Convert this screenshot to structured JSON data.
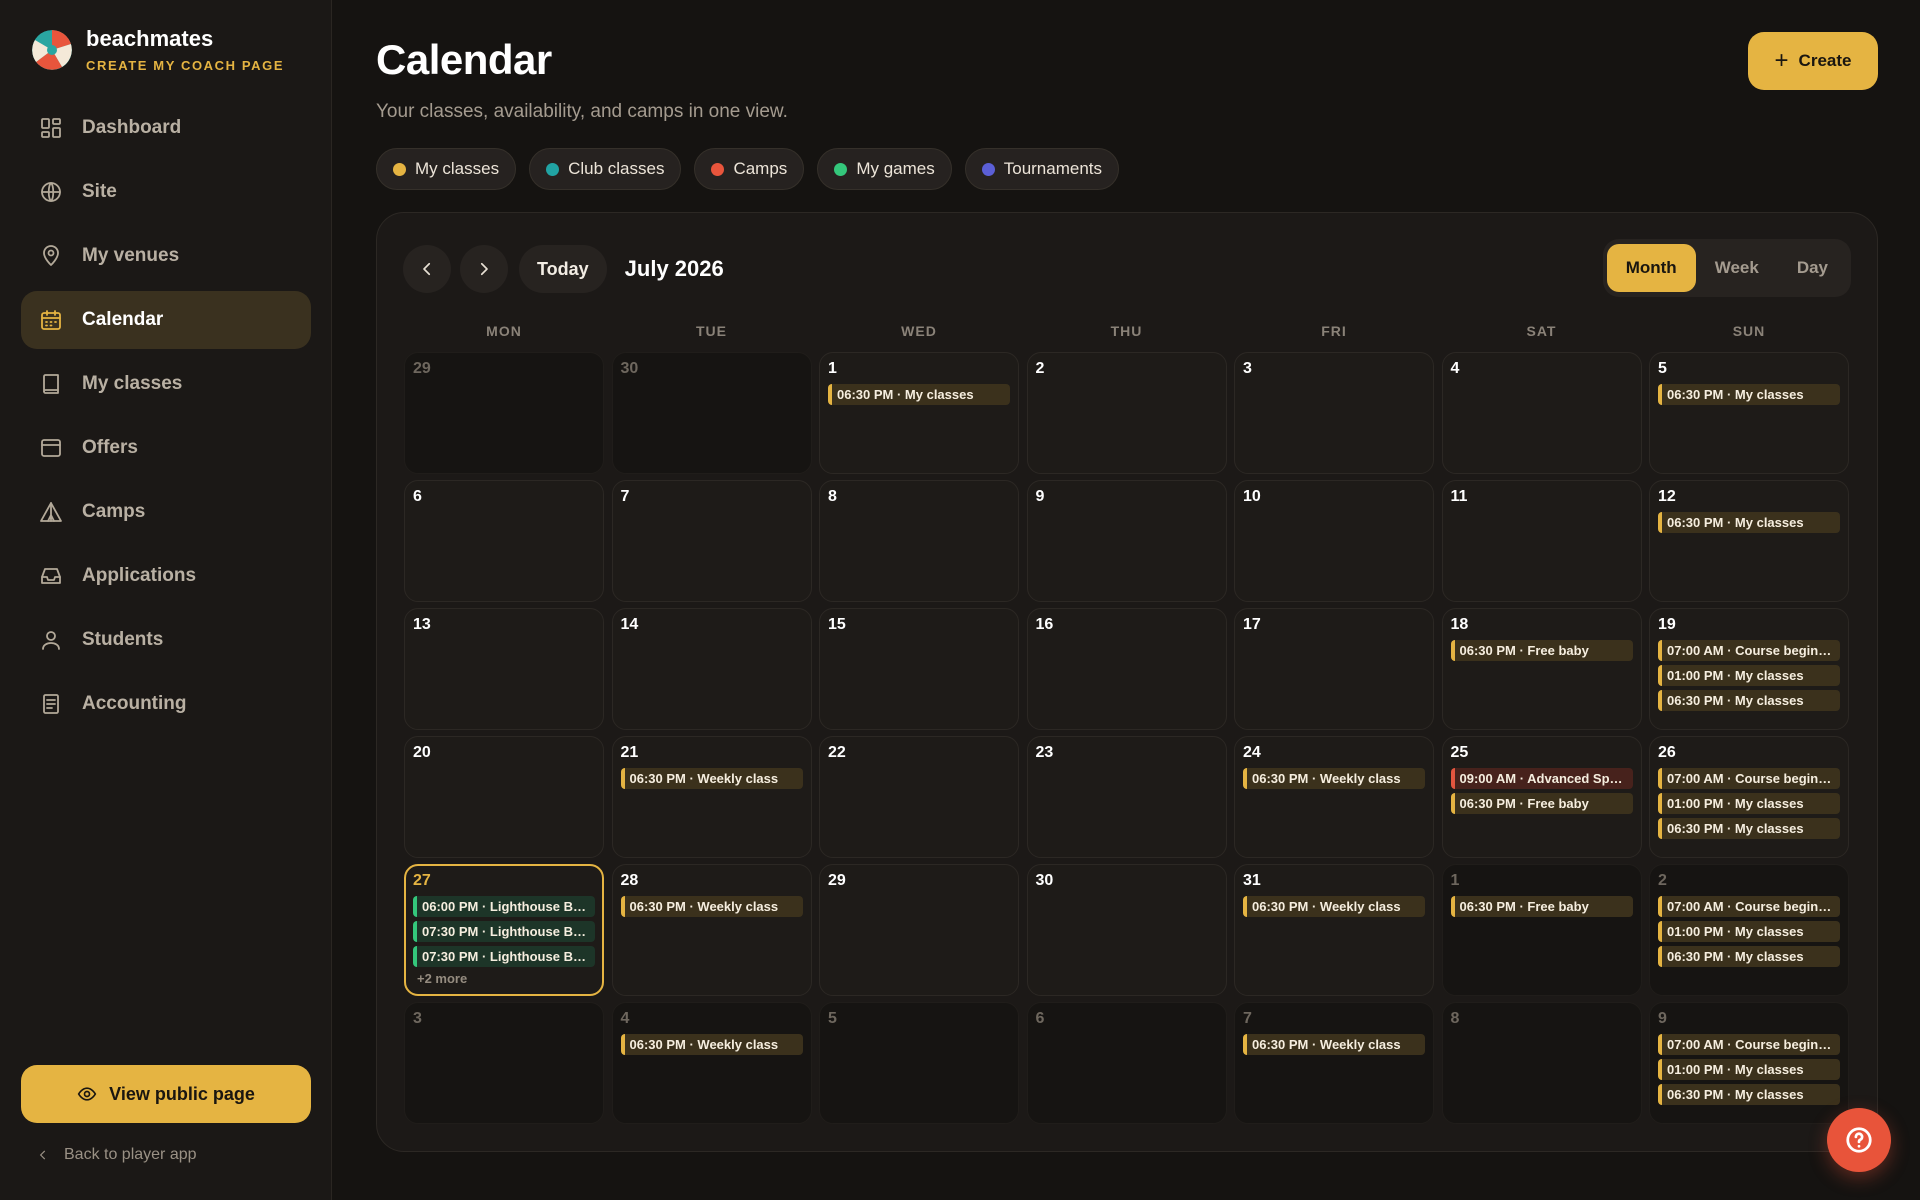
{
  "brand": {
    "name": "beachmates",
    "subtitle": "CREATE MY COACH PAGE"
  },
  "nav": [
    {
      "label": "Dashboard",
      "icon": "dashboard-icon",
      "active": false
    },
    {
      "label": "Site",
      "icon": "globe-icon",
      "active": false
    },
    {
      "label": "My venues",
      "icon": "map-pin-icon",
      "active": false
    },
    {
      "label": "Calendar",
      "icon": "calendar-icon",
      "active": true
    },
    {
      "label": "My classes",
      "icon": "book-icon",
      "active": false
    },
    {
      "label": "Offers",
      "icon": "box-icon",
      "active": false
    },
    {
      "label": "Camps",
      "icon": "tent-icon",
      "active": false
    },
    {
      "label": "Applications",
      "icon": "inbox-icon",
      "active": false
    },
    {
      "label": "Students",
      "icon": "user-icon",
      "active": false
    },
    {
      "label": "Accounting",
      "icon": "receipt-icon",
      "active": false
    }
  ],
  "sidebar_footer": {
    "public_page": "View public page",
    "back": "Back to player app"
  },
  "page": {
    "title": "Calendar",
    "subtitle": "Your classes, availability, and camps in one view.",
    "create_label": "Create"
  },
  "filters": [
    {
      "label": "My classes",
      "color": "#e5b442"
    },
    {
      "label": "Club classes",
      "color": "#21a3a3"
    },
    {
      "label": "Camps",
      "color": "#e8553c"
    },
    {
      "label": "My games",
      "color": "#34c77b"
    },
    {
      "label": "Tournaments",
      "color": "#5b5fd6"
    }
  ],
  "calendar": {
    "today_label": "Today",
    "month_label": "July 2026",
    "views": [
      "Month",
      "Week",
      "Day"
    ],
    "active_view": "Month",
    "weekdays": [
      "MON",
      "TUE",
      "WED",
      "THU",
      "FRI",
      "SAT",
      "SUN"
    ],
    "weeks": [
      [
        {
          "day": "29",
          "out": true,
          "events": []
        },
        {
          "day": "30",
          "out": true,
          "events": []
        },
        {
          "day": "1",
          "events": [
            {
              "text": "06:30 PM · My classes",
              "kind": "gold"
            }
          ]
        },
        {
          "day": "2",
          "events": []
        },
        {
          "day": "3",
          "events": []
        },
        {
          "day": "4",
          "events": []
        },
        {
          "day": "5",
          "events": [
            {
              "text": "06:30 PM · My classes",
              "kind": "gold"
            }
          ]
        }
      ],
      [
        {
          "day": "6",
          "events": []
        },
        {
          "day": "7",
          "events": []
        },
        {
          "day": "8",
          "events": []
        },
        {
          "day": "9",
          "events": []
        },
        {
          "day": "10",
          "events": []
        },
        {
          "day": "11",
          "events": []
        },
        {
          "day": "12",
          "events": [
            {
              "text": "06:30 PM · My classes",
              "kind": "gold"
            }
          ]
        }
      ],
      [
        {
          "day": "13",
          "events": []
        },
        {
          "day": "14",
          "events": []
        },
        {
          "day": "15",
          "events": []
        },
        {
          "day": "16",
          "events": []
        },
        {
          "day": "17",
          "events": []
        },
        {
          "day": "18",
          "events": [
            {
              "text": "06:30 PM · Free baby",
              "kind": "gold"
            }
          ]
        },
        {
          "day": "19",
          "events": [
            {
              "text": "07:00 AM · Course begin…",
              "kind": "gold"
            },
            {
              "text": "01:00 PM · My classes",
              "kind": "gold"
            },
            {
              "text": "06:30 PM · My classes",
              "kind": "gold"
            }
          ]
        }
      ],
      [
        {
          "day": "20",
          "events": []
        },
        {
          "day": "21",
          "events": [
            {
              "text": "06:30 PM · Weekly class",
              "kind": "gold"
            }
          ]
        },
        {
          "day": "22",
          "events": []
        },
        {
          "day": "23",
          "events": []
        },
        {
          "day": "24",
          "events": [
            {
              "text": "06:30 PM · Weekly class",
              "kind": "gold"
            }
          ]
        },
        {
          "day": "25",
          "events": [
            {
              "text": "09:00 AM · Advanced Sp…",
              "kind": "red"
            },
            {
              "text": "06:30 PM · Free baby",
              "kind": "gold"
            }
          ]
        },
        {
          "day": "26",
          "events": [
            {
              "text": "07:00 AM · Course begin…",
              "kind": "gold"
            },
            {
              "text": "01:00 PM · My classes",
              "kind": "gold"
            },
            {
              "text": "06:30 PM · My classes",
              "kind": "gold"
            }
          ]
        }
      ],
      [
        {
          "day": "27",
          "today": true,
          "more": "+2 more",
          "events": [
            {
              "text": "06:00 PM · Lighthouse B…",
              "kind": "green"
            },
            {
              "text": "07:30 PM · Lighthouse B…",
              "kind": "green"
            },
            {
              "text": "07:30 PM · Lighthouse B…",
              "kind": "green"
            }
          ]
        },
        {
          "day": "28",
          "events": [
            {
              "text": "06:30 PM · Weekly class",
              "kind": "gold"
            }
          ]
        },
        {
          "day": "29",
          "events": []
        },
        {
          "day": "30",
          "events": []
        },
        {
          "day": "31",
          "events": [
            {
              "text": "06:30 PM · Weekly class",
              "kind": "gold"
            }
          ]
        },
        {
          "day": "1",
          "out": true,
          "events": [
            {
              "text": "06:30 PM · Free baby",
              "kind": "gold"
            }
          ]
        },
        {
          "day": "2",
          "out": true,
          "events": [
            {
              "text": "07:00 AM · Course begin…",
              "kind": "gold"
            },
            {
              "text": "01:00 PM · My classes",
              "kind": "gold"
            },
            {
              "text": "06:30 PM · My classes",
              "kind": "gold"
            }
          ]
        }
      ],
      [
        {
          "day": "3",
          "out": true,
          "events": []
        },
        {
          "day": "4",
          "out": true,
          "events": [
            {
              "text": "06:30 PM · Weekly class",
              "kind": "gold"
            }
          ]
        },
        {
          "day": "5",
          "out": true,
          "events": []
        },
        {
          "day": "6",
          "out": true,
          "events": []
        },
        {
          "day": "7",
          "out": true,
          "events": [
            {
              "text": "06:30 PM · Weekly class",
              "kind": "gold"
            }
          ]
        },
        {
          "day": "8",
          "out": true,
          "events": []
        },
        {
          "day": "9",
          "out": true,
          "events": [
            {
              "text": "07:00 AM · Course begin…",
              "kind": "gold"
            },
            {
              "text": "01:00 PM · My classes",
              "kind": "gold"
            },
            {
              "text": "06:30 PM · My classes",
              "kind": "gold"
            }
          ]
        }
      ]
    ]
  },
  "help": {
    "icon": "help-icon"
  }
}
